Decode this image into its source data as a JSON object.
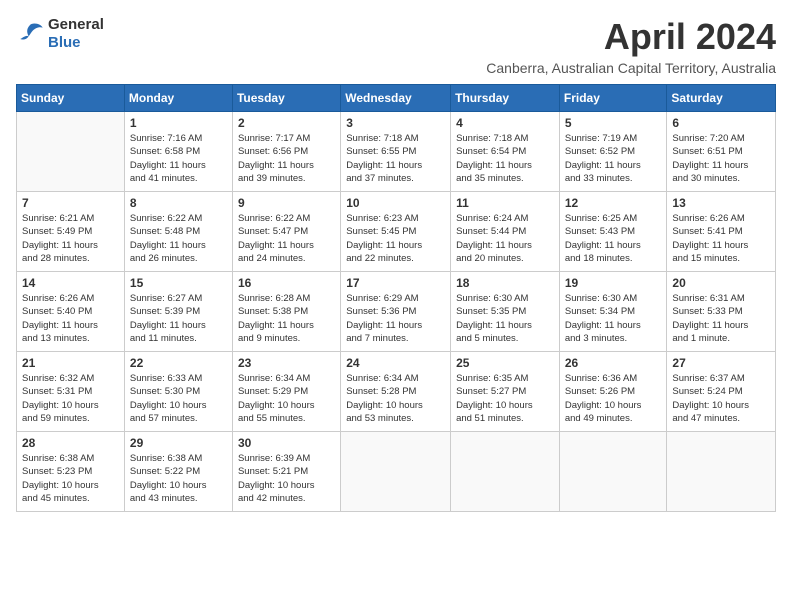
{
  "logo": {
    "general": "General",
    "blue": "Blue"
  },
  "title": "April 2024",
  "subtitle": "Canberra, Australian Capital Territory, Australia",
  "weekdays": [
    "Sunday",
    "Monday",
    "Tuesday",
    "Wednesday",
    "Thursday",
    "Friday",
    "Saturday"
  ],
  "weeks": [
    [
      {
        "day": null,
        "info": null
      },
      {
        "day": "1",
        "info": "Sunrise: 7:16 AM\nSunset: 6:58 PM\nDaylight: 11 hours\nand 41 minutes."
      },
      {
        "day": "2",
        "info": "Sunrise: 7:17 AM\nSunset: 6:56 PM\nDaylight: 11 hours\nand 39 minutes."
      },
      {
        "day": "3",
        "info": "Sunrise: 7:18 AM\nSunset: 6:55 PM\nDaylight: 11 hours\nand 37 minutes."
      },
      {
        "day": "4",
        "info": "Sunrise: 7:18 AM\nSunset: 6:54 PM\nDaylight: 11 hours\nand 35 minutes."
      },
      {
        "day": "5",
        "info": "Sunrise: 7:19 AM\nSunset: 6:52 PM\nDaylight: 11 hours\nand 33 minutes."
      },
      {
        "day": "6",
        "info": "Sunrise: 7:20 AM\nSunset: 6:51 PM\nDaylight: 11 hours\nand 30 minutes."
      }
    ],
    [
      {
        "day": "7",
        "info": "Sunrise: 6:21 AM\nSunset: 5:49 PM\nDaylight: 11 hours\nand 28 minutes."
      },
      {
        "day": "8",
        "info": "Sunrise: 6:22 AM\nSunset: 5:48 PM\nDaylight: 11 hours\nand 26 minutes."
      },
      {
        "day": "9",
        "info": "Sunrise: 6:22 AM\nSunset: 5:47 PM\nDaylight: 11 hours\nand 24 minutes."
      },
      {
        "day": "10",
        "info": "Sunrise: 6:23 AM\nSunset: 5:45 PM\nDaylight: 11 hours\nand 22 minutes."
      },
      {
        "day": "11",
        "info": "Sunrise: 6:24 AM\nSunset: 5:44 PM\nDaylight: 11 hours\nand 20 minutes."
      },
      {
        "day": "12",
        "info": "Sunrise: 6:25 AM\nSunset: 5:43 PM\nDaylight: 11 hours\nand 18 minutes."
      },
      {
        "day": "13",
        "info": "Sunrise: 6:26 AM\nSunset: 5:41 PM\nDaylight: 11 hours\nand 15 minutes."
      }
    ],
    [
      {
        "day": "14",
        "info": "Sunrise: 6:26 AM\nSunset: 5:40 PM\nDaylight: 11 hours\nand 13 minutes."
      },
      {
        "day": "15",
        "info": "Sunrise: 6:27 AM\nSunset: 5:39 PM\nDaylight: 11 hours\nand 11 minutes."
      },
      {
        "day": "16",
        "info": "Sunrise: 6:28 AM\nSunset: 5:38 PM\nDaylight: 11 hours\nand 9 minutes."
      },
      {
        "day": "17",
        "info": "Sunrise: 6:29 AM\nSunset: 5:36 PM\nDaylight: 11 hours\nand 7 minutes."
      },
      {
        "day": "18",
        "info": "Sunrise: 6:30 AM\nSunset: 5:35 PM\nDaylight: 11 hours\nand 5 minutes."
      },
      {
        "day": "19",
        "info": "Sunrise: 6:30 AM\nSunset: 5:34 PM\nDaylight: 11 hours\nand 3 minutes."
      },
      {
        "day": "20",
        "info": "Sunrise: 6:31 AM\nSunset: 5:33 PM\nDaylight: 11 hours\nand 1 minute."
      }
    ],
    [
      {
        "day": "21",
        "info": "Sunrise: 6:32 AM\nSunset: 5:31 PM\nDaylight: 10 hours\nand 59 minutes."
      },
      {
        "day": "22",
        "info": "Sunrise: 6:33 AM\nSunset: 5:30 PM\nDaylight: 10 hours\nand 57 minutes."
      },
      {
        "day": "23",
        "info": "Sunrise: 6:34 AM\nSunset: 5:29 PM\nDaylight: 10 hours\nand 55 minutes."
      },
      {
        "day": "24",
        "info": "Sunrise: 6:34 AM\nSunset: 5:28 PM\nDaylight: 10 hours\nand 53 minutes."
      },
      {
        "day": "25",
        "info": "Sunrise: 6:35 AM\nSunset: 5:27 PM\nDaylight: 10 hours\nand 51 minutes."
      },
      {
        "day": "26",
        "info": "Sunrise: 6:36 AM\nSunset: 5:26 PM\nDaylight: 10 hours\nand 49 minutes."
      },
      {
        "day": "27",
        "info": "Sunrise: 6:37 AM\nSunset: 5:24 PM\nDaylight: 10 hours\nand 47 minutes."
      }
    ],
    [
      {
        "day": "28",
        "info": "Sunrise: 6:38 AM\nSunset: 5:23 PM\nDaylight: 10 hours\nand 45 minutes."
      },
      {
        "day": "29",
        "info": "Sunrise: 6:38 AM\nSunset: 5:22 PM\nDaylight: 10 hours\nand 43 minutes."
      },
      {
        "day": "30",
        "info": "Sunrise: 6:39 AM\nSunset: 5:21 PM\nDaylight: 10 hours\nand 42 minutes."
      },
      {
        "day": null,
        "info": null
      },
      {
        "day": null,
        "info": null
      },
      {
        "day": null,
        "info": null
      },
      {
        "day": null,
        "info": null
      }
    ]
  ]
}
